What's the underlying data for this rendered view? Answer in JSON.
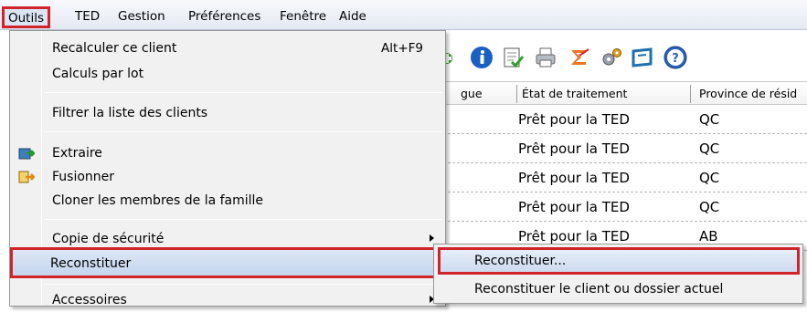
{
  "menubar": {
    "items": [
      {
        "label": "Outils",
        "active": true
      },
      {
        "label": "TED"
      },
      {
        "label": "Gestion"
      },
      {
        "label": "Préférences"
      },
      {
        "label": "Fenêtre"
      },
      {
        "label": "Aide"
      }
    ]
  },
  "toolbar": {
    "icons": [
      "plus-icon",
      "info-icon",
      "checklist-icon",
      "printer-icon",
      "sigma-icon",
      "gears-icon",
      "window-icon",
      "help-icon"
    ]
  },
  "grid": {
    "headers": [
      "gue",
      "État de traitement",
      "Province de résid"
    ],
    "rows": [
      {
        "status": "Prêt pour la TED",
        "province": "QC"
      },
      {
        "status": "Prêt pour la TED",
        "province": "QC"
      },
      {
        "status": "Prêt pour la TED",
        "province": "QC"
      },
      {
        "status": "Prêt pour la TED",
        "province": "QC"
      },
      {
        "status": "Prêt pour la TED",
        "province": "AB"
      }
    ]
  },
  "outils_menu": {
    "items": [
      {
        "label": "Recalculer ce client",
        "shortcut": "Alt+F9"
      },
      {
        "label": "Calculs par lot"
      },
      {
        "label": "Filtrer la liste des clients"
      },
      {
        "label": "Extraire",
        "icon": "extract-icon"
      },
      {
        "label": "Fusionner",
        "icon": "merge-icon"
      },
      {
        "label": "Cloner les membres de la famille"
      },
      {
        "label": "Copie de sécurité",
        "submenu": true
      },
      {
        "label": "Reconstituer",
        "submenu": true,
        "highlighted": true
      },
      {
        "label": "Accessoires",
        "submenu": true
      }
    ]
  },
  "reconstituer_submenu": {
    "items": [
      {
        "label": "Reconstituer...",
        "highlighted": true
      },
      {
        "label": "Reconstituer le client ou dossier actuel"
      }
    ]
  },
  "colors": {
    "highlight_border": "#d2232a",
    "menu_bg": "#f1f1f1",
    "selection_bg": "#c3d5ee"
  }
}
